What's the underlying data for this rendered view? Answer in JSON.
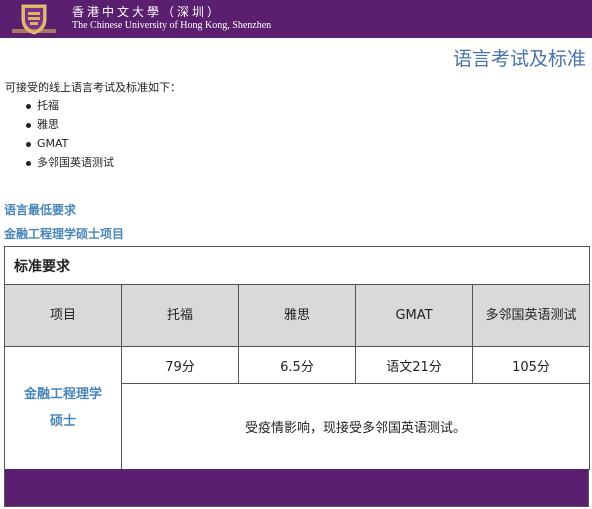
{
  "header": {
    "logo_icon": "cuhk-shield-crest",
    "name_zh": "香港中文大學（深圳）",
    "name_en": "The Chinese University of Hong Kong, Shenzhen",
    "brand_color": "#5a1f6e"
  },
  "page_title": "语言考试及标准",
  "intro": "可接受的线上语言考试及标准如下：",
  "exams": [
    {
      "label": "托福"
    },
    {
      "label": "雅思"
    },
    {
      "label": "GMAT"
    },
    {
      "label": "多邻国英语测试"
    }
  ],
  "heading_min": "语言最低要求",
  "heading_program": "金融工程理学硕士项目",
  "table": {
    "caption": "标准要求",
    "headers": [
      "项目",
      "托福",
      "雅思",
      "GMAT",
      "多邻国英语测试"
    ],
    "program": "金融工程理学硕士",
    "scores": [
      "79分",
      "6.5分",
      "语文21分",
      "105分"
    ],
    "note": "受疫情影响，现接受多邻国英语测试。",
    "header_bg": "#d9d9d9",
    "accent_color": "#4a86b8"
  }
}
